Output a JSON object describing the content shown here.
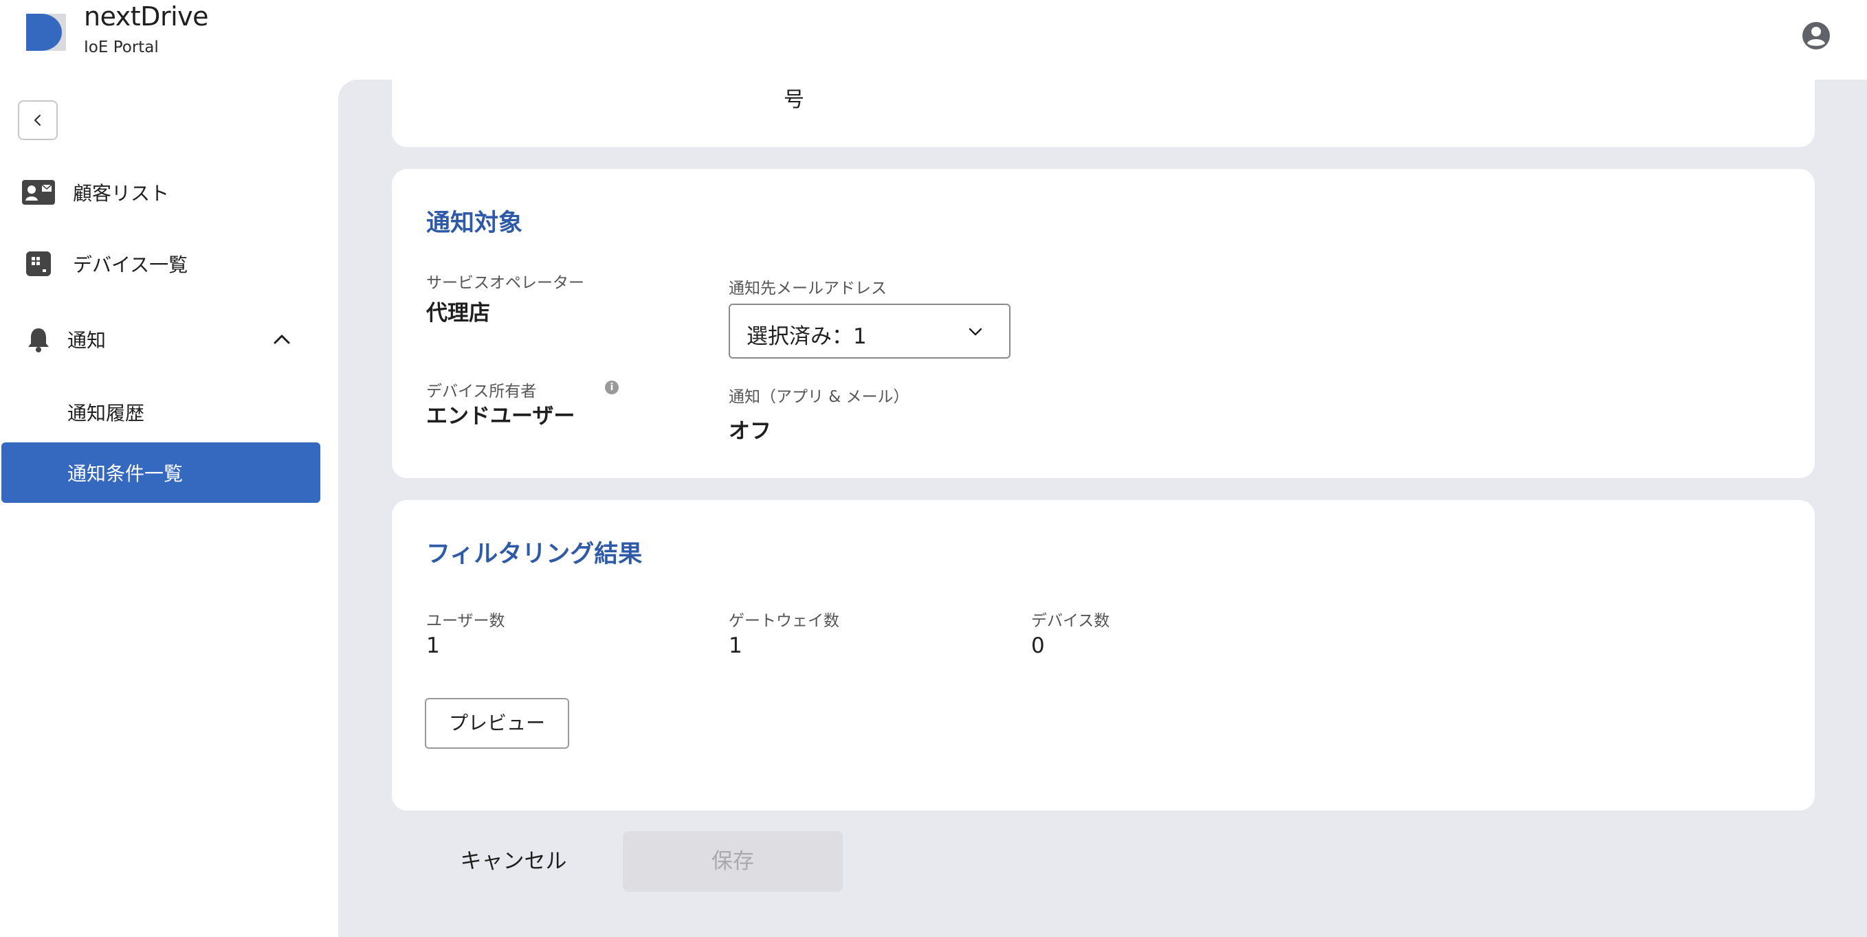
{
  "header": {
    "brand_name": "nextDrive",
    "brand_sub": "IoE Portal"
  },
  "sidebar": {
    "items": [
      {
        "label": "顧客リスト",
        "icon": "contact-card-icon"
      },
      {
        "label": "デバイス一覧",
        "icon": "device-icon"
      },
      {
        "label": "通知",
        "icon": "bell-icon",
        "expanded": true
      }
    ],
    "sub_items": [
      {
        "label": "通知履歴",
        "active": false
      },
      {
        "label": "通知条件一覧",
        "active": true
      }
    ]
  },
  "top_card": {
    "truncated_text": "号"
  },
  "notification_target": {
    "title": "通知対象",
    "service_operator_label": "サービスオペレーター",
    "service_operator_value": "代理店",
    "email_label": "通知先メールアドレス",
    "email_select_value": "選択済み：1",
    "device_owner_label": "デバイス所有者",
    "device_owner_value": "エンドユーザー",
    "app_mail_label": "通知（アプリ & メール）",
    "app_mail_value": "オフ"
  },
  "filtering_result": {
    "title": "フィルタリング結果",
    "users_label": "ユーザー数",
    "users_value": "1",
    "gateways_label": "ゲートウェイ数",
    "gateways_value": "1",
    "devices_label": "デバイス数",
    "devices_value": "0",
    "preview_label": "プレビュー"
  },
  "actions": {
    "cancel_label": "キャンセル",
    "save_label": "保存"
  },
  "colors": {
    "accent": "#3568bf",
    "section_title": "#2f5aa8",
    "background": "#e8e9ee",
    "disabled_bg": "#dddde2"
  }
}
